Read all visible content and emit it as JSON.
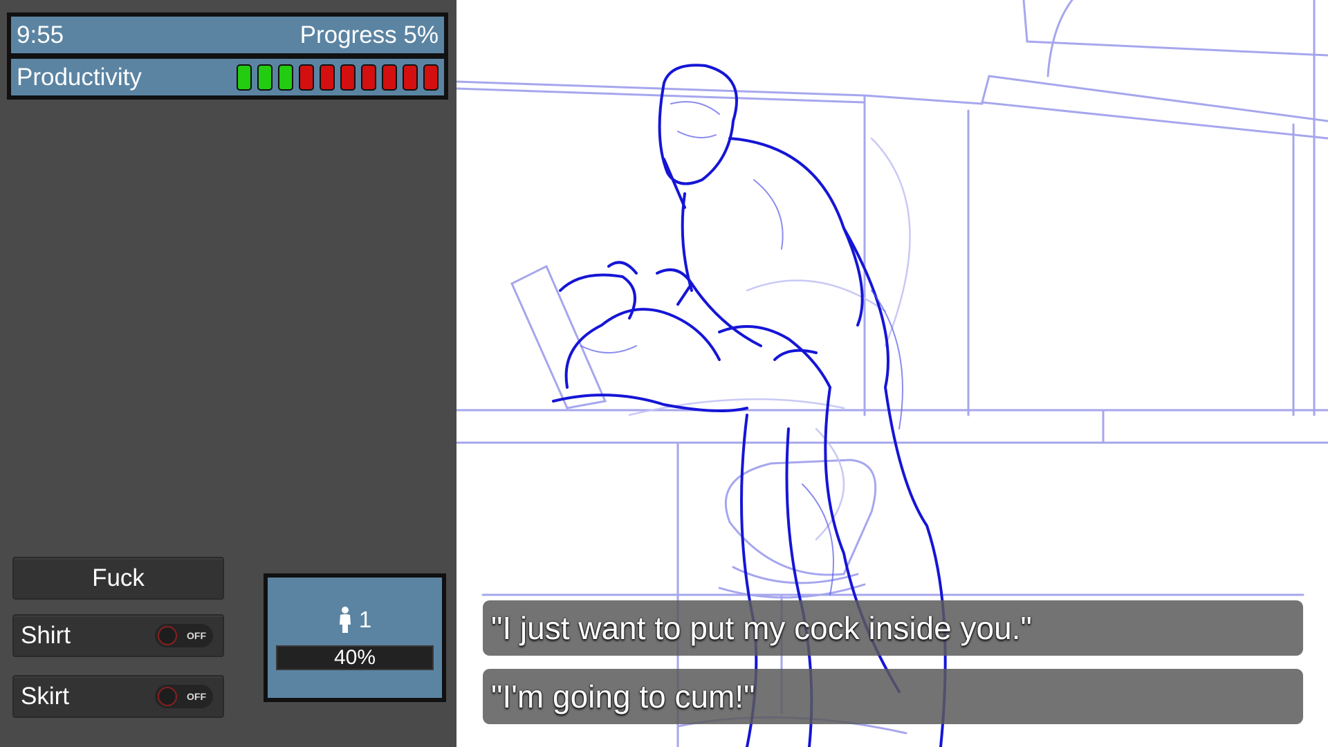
{
  "hud": {
    "time": "9:55",
    "progress_label": "Progress 5%",
    "productivity_label": "Productivity",
    "productivity_segments": [
      "green",
      "green",
      "green",
      "red",
      "red",
      "red",
      "red",
      "red",
      "red",
      "red"
    ],
    "colors": {
      "green": "#22cc11",
      "red": "#d40f0f",
      "panel": "#5b84a2"
    }
  },
  "actions": {
    "fuck_label": "Fuck",
    "shirt_label": "Shirt",
    "shirt_toggle": "OFF",
    "skirt_label": "Skirt",
    "skirt_toggle": "OFF"
  },
  "counter": {
    "icon": "person-icon",
    "count": "1",
    "percent": "40%"
  },
  "dialogue": {
    "line_1": "\"I just want to put my cock inside you.\"",
    "line_2": "\"I'm going to cum!\""
  }
}
